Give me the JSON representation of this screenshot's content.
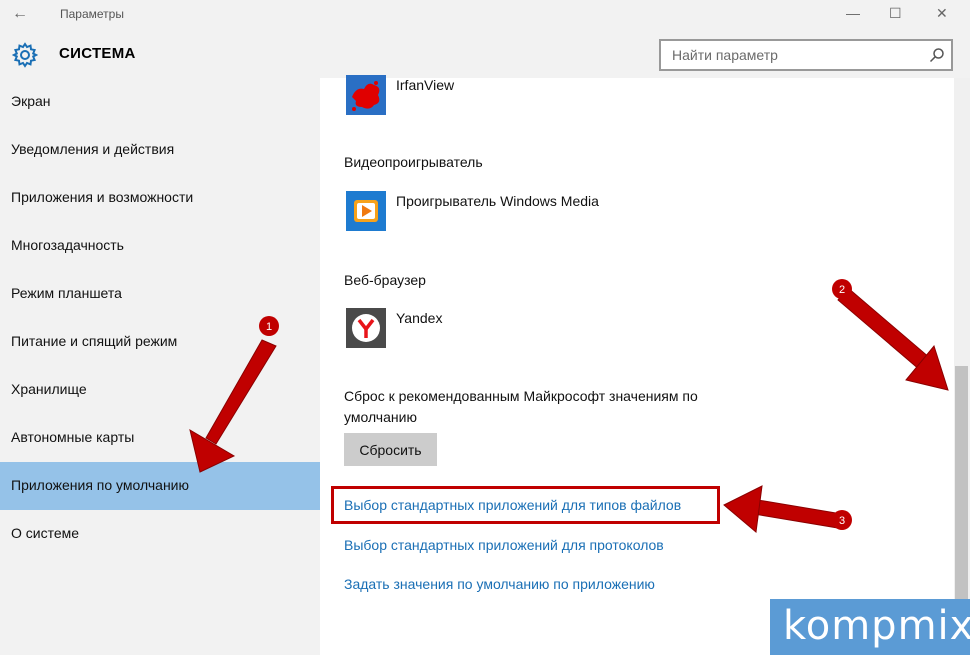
{
  "window": {
    "title": "Параметры",
    "back_glyph": "←",
    "min_glyph": "—",
    "max_glyph": "☐",
    "close_glyph": "✕"
  },
  "header": {
    "title": "СИСТЕМА",
    "icon": "gear-icon",
    "search": {
      "placeholder": "Найти параметр",
      "icon": "search-icon"
    }
  },
  "sidebar": {
    "items": [
      {
        "label": "Экран"
      },
      {
        "label": "Уведомления и действия"
      },
      {
        "label": "Приложения и возможности"
      },
      {
        "label": "Многозадачность"
      },
      {
        "label": "Режим планшета"
      },
      {
        "label": "Питание и спящий режим"
      },
      {
        "label": "Хранилище"
      },
      {
        "label": "Автономные карты"
      },
      {
        "label": "Приложения по умолчанию",
        "selected": true
      },
      {
        "label": "О системе"
      }
    ]
  },
  "content": {
    "photo_viewer": {
      "app": "IrfanView",
      "icon": "irfanview-icon"
    },
    "video": {
      "category": "Видеопроигрыватель",
      "app": "Проигрыватель Windows Media",
      "icon": "windows-media-player-icon"
    },
    "browser": {
      "category": "Веб-браузер",
      "app": "Yandex",
      "icon": "yandex-browser-icon"
    },
    "reset": {
      "text": "Сброс к рекомендованным Майкрософт значениям по умолчанию",
      "button": "Сбросить"
    },
    "links": [
      "Выбор стандартных приложений для типов файлов",
      "Выбор стандартных приложений для протоколов",
      "Задать значения по умолчанию по приложению"
    ]
  },
  "annotations": {
    "badges": [
      "1",
      "2",
      "3"
    ],
    "color": "#c00000"
  },
  "watermark": {
    "text": "kompmix"
  },
  "colors": {
    "accent": "#95c2e8",
    "link": "#1a6fb5",
    "chrome": "#f2f2f2"
  }
}
